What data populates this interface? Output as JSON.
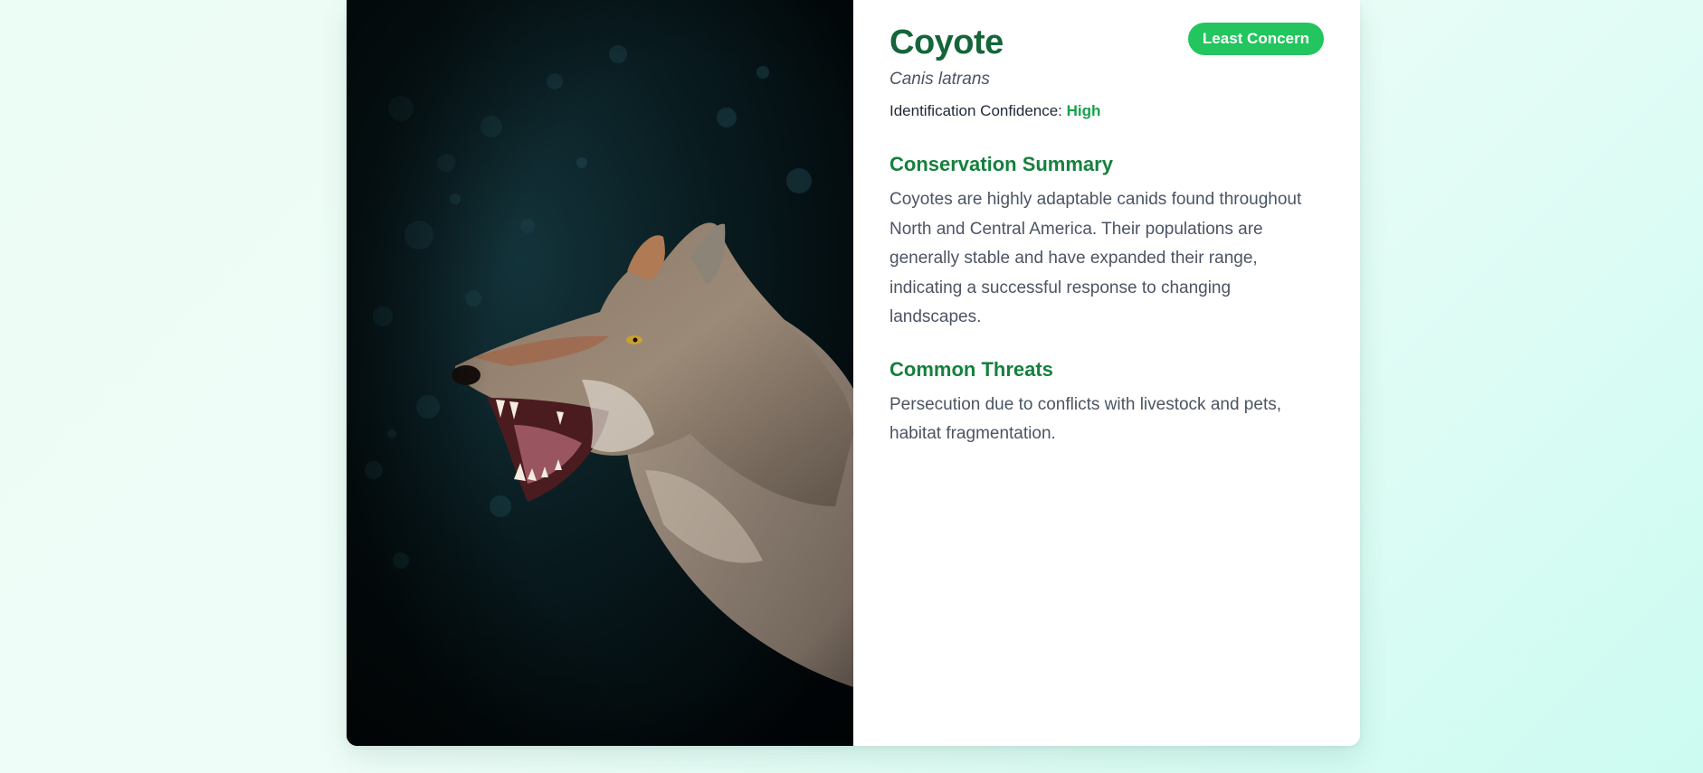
{
  "species": {
    "common_name": "Coyote",
    "scientific_name": "Canis latrans",
    "status_badge": "Least Concern",
    "confidence_label": "Identification Confidence:",
    "confidence_value": "High"
  },
  "sections": {
    "conservation": {
      "heading": "Conservation Summary",
      "text": "Coyotes are highly adaptable canids found throughout North and Central America. Their populations are generally stable and have expanded their range, indicating a successful response to changing landscapes."
    },
    "threats": {
      "heading": "Common Threats",
      "text": "Persecution due to conflicts with livestock and pets, habitat fragmentation."
    }
  },
  "colors": {
    "title": "#14653a",
    "heading": "#15803d",
    "badge": "#22c55e",
    "confidence_value": "#16a34a",
    "body_text": "#4b5563"
  },
  "image": {
    "subject": "coyote-snarling-photo"
  }
}
